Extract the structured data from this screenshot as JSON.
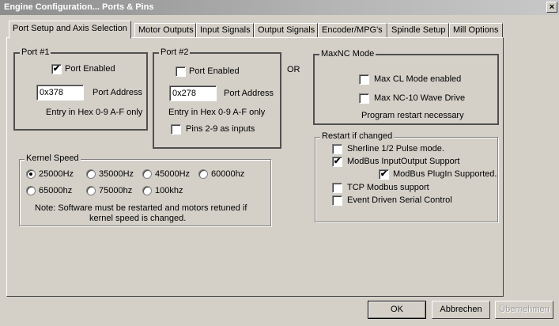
{
  "window": {
    "title": "Engine Configuration... Ports & Pins",
    "close_glyph": "×"
  },
  "tabs": [
    {
      "label": "Port Setup and Axis Selection",
      "active": true
    },
    {
      "label": "Motor Outputs"
    },
    {
      "label": "Input Signals"
    },
    {
      "label": "Output Signals"
    },
    {
      "label": "Encoder/MPG's"
    },
    {
      "label": "Spindle Setup"
    },
    {
      "label": "Mill Options"
    }
  ],
  "port1": {
    "legend": "Port #1",
    "enabled_label": "Port Enabled",
    "enabled": true,
    "address_value": "0x378",
    "address_label": "Port Address",
    "hint": "Entry in Hex 0-9 A-F only"
  },
  "port2": {
    "legend": "Port #2",
    "enabled_label": "Port Enabled",
    "enabled": false,
    "address_value": "0x278",
    "address_label": "Port Address",
    "hint": "Entry in Hex 0-9 A-F only",
    "pins_label": "Pins 2-9 as inputs",
    "pins_checked": false
  },
  "or_label": "OR",
  "maxnc": {
    "legend": "MaxNC Mode",
    "cl_label": "Max CL Mode enabled",
    "cl_checked": false,
    "wave_label": "Max NC-10 Wave Drive",
    "wave_checked": false,
    "note": "Program restart necessary"
  },
  "kernel": {
    "legend": "Kernel Speed",
    "options": [
      "25000Hz",
      "35000Hz",
      "45000Hz",
      "60000hz",
      "65000hz",
      "75000hz",
      "100khz"
    ],
    "selected": "25000Hz",
    "note_line1": "Note: Software must be restarted and motors retuned if",
    "note_line2": "kernel speed is changed."
  },
  "restart": {
    "legend": "Restart if changed",
    "sherline_label": "Sherline 1/2 Pulse mode.",
    "sherline_checked": false,
    "modbus_label": "ModBus InputOutput Support",
    "modbus_checked": true,
    "plugin_label": "ModBus PlugIn Supported.",
    "plugin_checked": true,
    "tcp_label": "TCP Modbus support",
    "tcp_checked": false,
    "event_label": "Event Driven Serial Control",
    "event_checked": false
  },
  "buttons": {
    "ok": "OK",
    "cancel": "Abbrechen",
    "apply": "Übernehmen"
  },
  "glyphs": {
    "check": "✔"
  }
}
